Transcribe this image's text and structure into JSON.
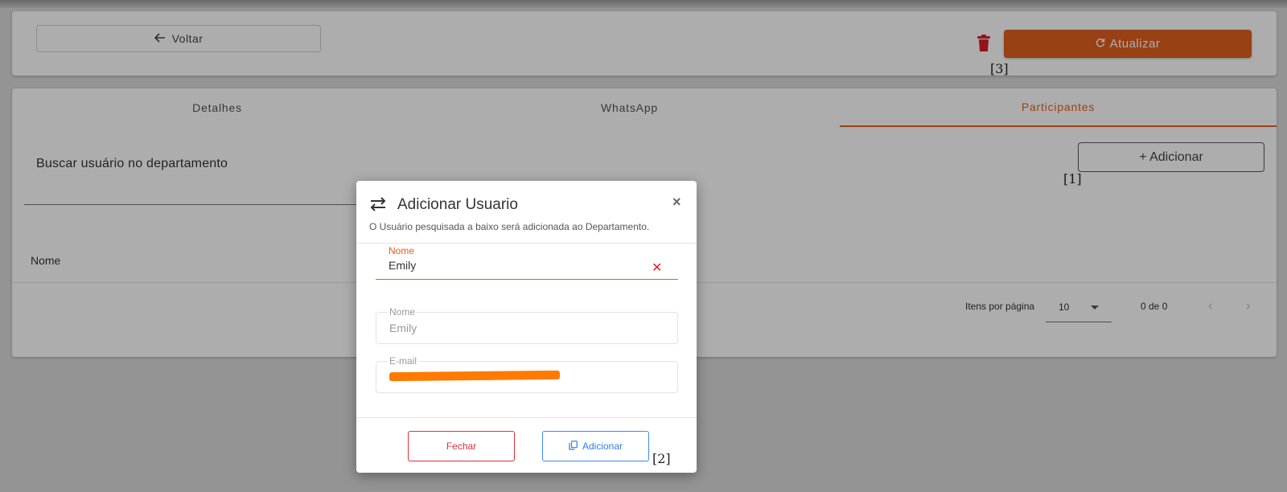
{
  "top": {
    "back_label": "Voltar",
    "update_label": "Atualizar"
  },
  "markers": {
    "m1": "[1]",
    "m2": "[2]",
    "m3": "[3]"
  },
  "tabs": [
    {
      "label": "Detalhes",
      "active": false
    },
    {
      "label": "WhatsApp",
      "active": false
    },
    {
      "label": "Participantes",
      "active": true
    }
  ],
  "participants": {
    "search_label": "Buscar usuário no departamento",
    "add_label": "+ Adicionar",
    "column_name": "Nome",
    "items_per_page_label": "Itens por página",
    "items_per_page_value": "10",
    "range": "0 de 0",
    "prev": "‹",
    "next": "›"
  },
  "modal": {
    "title": "Adicionar Usuario",
    "subtitle": "O Usuário pesquisada a baixo será adicionada ao Departamento.",
    "close": "×",
    "search_field": {
      "label": "Nome",
      "value": "Emily",
      "clear": "✕"
    },
    "name_field": {
      "label": "Nome",
      "value": "Emily"
    },
    "email_field": {
      "label": "E-mail",
      "value": ""
    },
    "close_button": "Fechar",
    "add_button": "Adicionar"
  },
  "colors": {
    "accent": "#e0601f",
    "danger": "#e0303a",
    "primary": "#2f7fe0",
    "redaction": "#ff7a00"
  },
  "icons": {
    "back": "arrow-left-icon",
    "trash": "trash-icon",
    "refresh": "refresh-icon",
    "swap": "swap-arrows-icon",
    "close": "close-icon",
    "clear": "clear-icon",
    "copy": "copy-icon",
    "dropdown": "caret-down-icon"
  }
}
